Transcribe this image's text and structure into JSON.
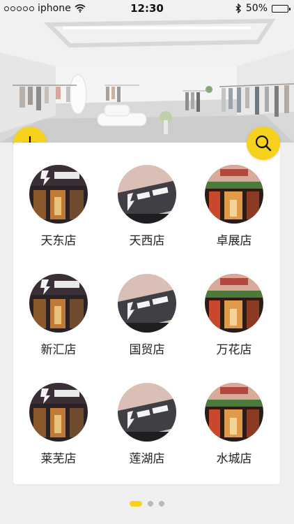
{
  "status_bar": {
    "carrier": "iphone",
    "time": "12:30",
    "battery": "50%",
    "battery_level": 0.5
  },
  "actions": {
    "add_icon": "plus-icon",
    "search_icon": "search-icon"
  },
  "stores": [
    {
      "name": "天东店",
      "style": "a"
    },
    {
      "name": "天西店",
      "style": "b"
    },
    {
      "name": "卓展店",
      "style": "c"
    },
    {
      "name": "新汇店",
      "style": "a"
    },
    {
      "name": "国贸店",
      "style": "b"
    },
    {
      "name": "万花店",
      "style": "c"
    },
    {
      "name": "莱芜店",
      "style": "a"
    },
    {
      "name": "莲湖店",
      "style": "b"
    },
    {
      "name": "水城店",
      "style": "c"
    }
  ],
  "pager": {
    "pages": 3,
    "current": 1
  },
  "colors": {
    "accent": "#f6d21f",
    "background": "#efeff1",
    "card": "#ffffff"
  }
}
